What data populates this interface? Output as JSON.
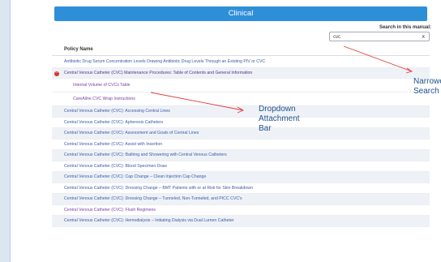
{
  "header": {
    "title": "Clinical"
  },
  "search": {
    "label": "Search in this manual:",
    "value": "cvc",
    "clear_glyph": "x"
  },
  "table": {
    "column_header": "Policy Name",
    "rows": [
      "Antibiotic Drug Serum Concentration Levels Drawing Antibiotic Drug Levels Through an Existing PIV or CVC",
      "Central Venous Catheter (CVC) Maintenance Procedures: Table of Contents and General Information",
      "Internal Volume of CVCs Table",
      "CareAline CVC Wrap Instructions",
      "Central Venous Catheter (CVC): Accessing Central Lines",
      "Central Venous Catheter (CVC): Apheresis Catheters",
      "Central Venous Catheter (CVC): Assessment and Goals of Central Lines",
      "Central Venous Catheter (CVC): Assist with Insertion",
      "Central Venous Catheter (CVC): Bathing and Showering with Central Venous Catheters",
      "Central Venous Catheter (CVC): Blood Specimen Draw",
      "Central Venous Catheter (CVC): Cap Change – Clean Injection Cap Change",
      "Central Venous Catheter (CVC): Dressing Change – BMT Patients with or at Risk for Skin Breakdown",
      "Central Venous Catheter (CVC): Dressing Change – Tunneled, Non-Tunneled, and PICC CVC's",
      "Central Venous Catheter (CVC): Flush Regimens",
      "Central Venous Catheter (CVC): Hemodialysis – Initiating Dialysis via Dual Lumen Catheter"
    ]
  },
  "annotations": {
    "narrowed": [
      "Narrowed",
      "Search"
    ],
    "dropdown": [
      "Dropdown",
      "Attachment",
      "Bar"
    ]
  },
  "colors": {
    "header_bar": "#2e8fd9",
    "link": "#3d5aa8",
    "expanded_link": "#5a2e8e",
    "collapse_icon": "#d8312f",
    "arrow": "#e23b3b"
  }
}
